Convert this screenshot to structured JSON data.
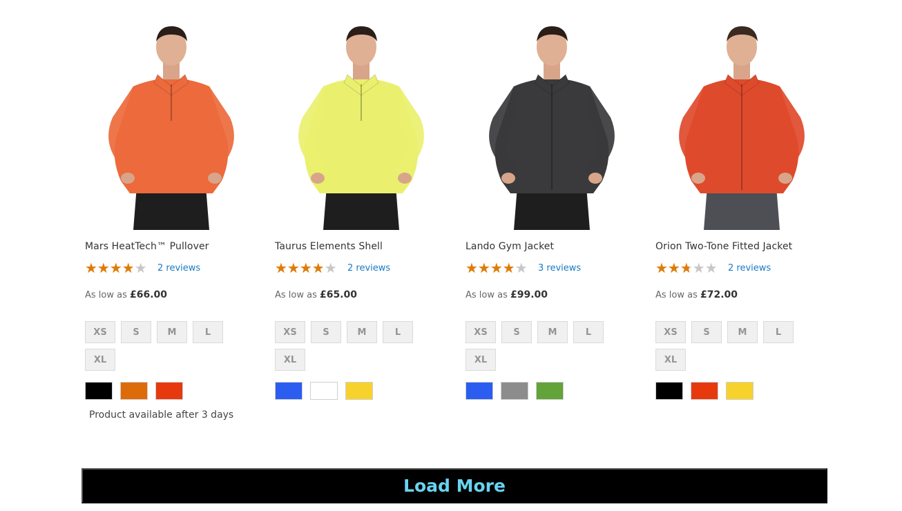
{
  "products": [
    {
      "name": "Mars HeatTech™ Pullover",
      "rating_fraction": 0.7,
      "reviews": "2 reviews",
      "price_prefix": "As low as",
      "price": "£66.00",
      "sizes": [
        "XS",
        "S",
        "M",
        "L",
        "XL"
      ],
      "colors": [
        "#000000",
        "#dd6b0a",
        "#e63a0e"
      ],
      "availability": "Product available after 3 days",
      "shirt_color": "#ec6a3c"
    },
    {
      "name": "Taurus Elements Shell",
      "rating_fraction": 0.7,
      "reviews": "2 reviews",
      "price_prefix": "As low as",
      "price": "£65.00",
      "sizes": [
        "XS",
        "S",
        "M",
        "L",
        "XL"
      ],
      "colors": [
        "#2a5df0",
        "#ffffff",
        "#f7d22c"
      ],
      "availability": "",
      "shirt_color": "#eaf06e"
    },
    {
      "name": "Lando Gym Jacket",
      "rating_fraction": 0.7,
      "reviews": "3 reviews",
      "price_prefix": "As low as",
      "price": "£99.00",
      "sizes": [
        "XS",
        "S",
        "M",
        "L",
        "XL"
      ],
      "colors": [
        "#2a5df0",
        "#8c8c8c",
        "#62a33a"
      ],
      "availability": "",
      "shirt_color": "#3a3a3c"
    },
    {
      "name": "Orion Two-Tone Fitted Jacket",
      "rating_fraction": 0.5,
      "reviews": "2 reviews",
      "price_prefix": "As low as",
      "price": "£72.00",
      "sizes": [
        "XS",
        "S",
        "M",
        "L",
        "XL"
      ],
      "colors": [
        "#000000",
        "#e63a0e",
        "#f7d22c"
      ],
      "availability": "",
      "shirt_color": "#de4a2c"
    }
  ],
  "load_more": "Load More",
  "star_glyphs": "★★★★★"
}
